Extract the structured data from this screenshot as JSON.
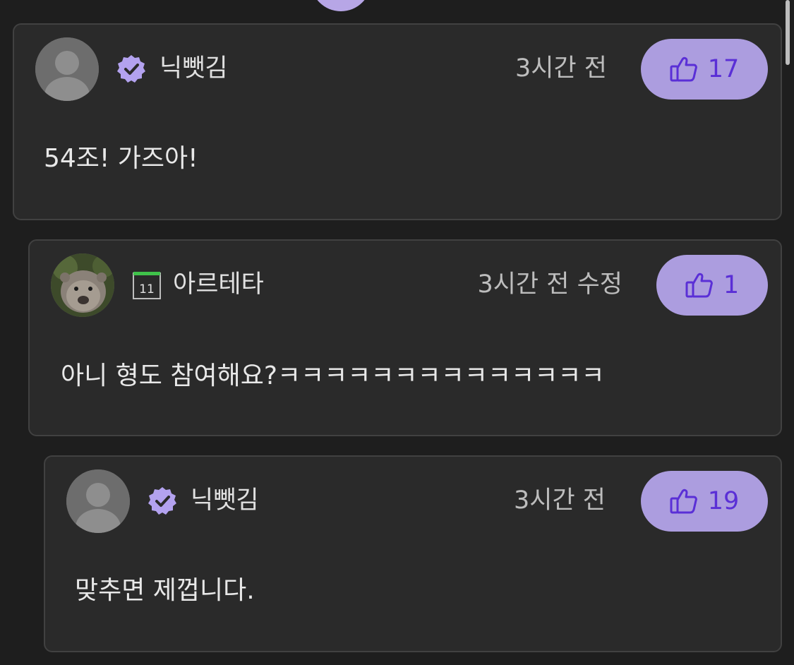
{
  "comments": [
    {
      "author": "닉뺏김",
      "badge_icon": "verified-badge-icon",
      "time": "3시간 전",
      "likes": "17",
      "text": "54조! 가즈아!"
    },
    {
      "author": "아르테타",
      "badge_icon": "calendar-icon",
      "badge_number": "11",
      "time": "3시간 전 수정",
      "likes": "1",
      "text": "아니 형도 참여해요?ㅋㅋㅋㅋㅋㅋㅋㅋㅋㅋㅋㅋㅋㅋ"
    },
    {
      "author": "닉뺏김",
      "badge_icon": "verified-badge-icon",
      "time": "3시간 전",
      "likes": "19",
      "text": "맞추면 제껍니다."
    }
  ],
  "colors": {
    "background": "#1e1e1e",
    "card": "#2a2a2a",
    "accent": "#ac9ddf",
    "like_text": "#5a2fd6"
  }
}
